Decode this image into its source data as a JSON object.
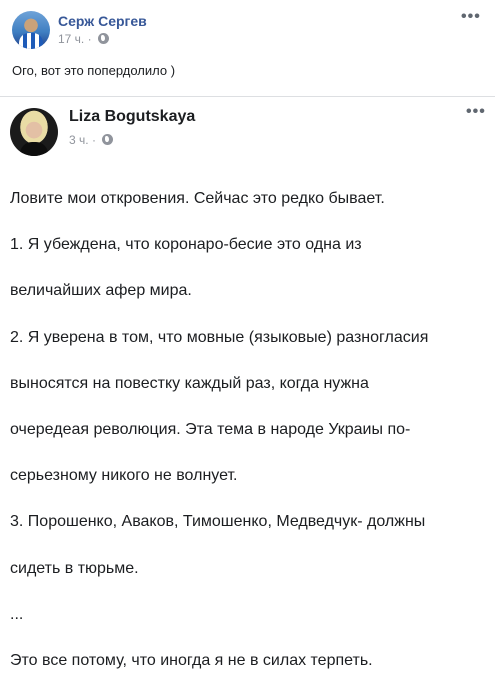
{
  "outer_post": {
    "author": "Серж Сергев",
    "time": "17 ч.",
    "separator": "·",
    "text": "Ого, вот это попердолило )"
  },
  "shared_post": {
    "author": "Liza Bogutskaya",
    "time": "3 ч.",
    "separator": "·",
    "lines": [
      "Ловите мои откровения. Сейчас это редко бывает.",
      "1. Я убеждена, что коронаро-бесие это одна из",
      "величайших афер мира.",
      "2. Я уверена в том, что мовные (языковые) разногласия",
      "выносятся на повестку каждый раз, когда нужна",
      "очередеая революция. Эта тема в народе Украиы по-",
      "серьезному никого не волнует.",
      "3. Порошенко, Аваков, Тимошенко, Медведчук- должны",
      "сидеть в тюрьме.",
      "...",
      "Это все потому, что иногда я не в силах терпеть."
    ]
  },
  "menu_glyph": "•••",
  "icons": {
    "privacy": "globe-icon",
    "menu": "more-options-icon"
  },
  "colors": {
    "link": "#385898",
    "meta": "#90949c",
    "text": "#1c1e21",
    "divider": "#dddfe2"
  }
}
